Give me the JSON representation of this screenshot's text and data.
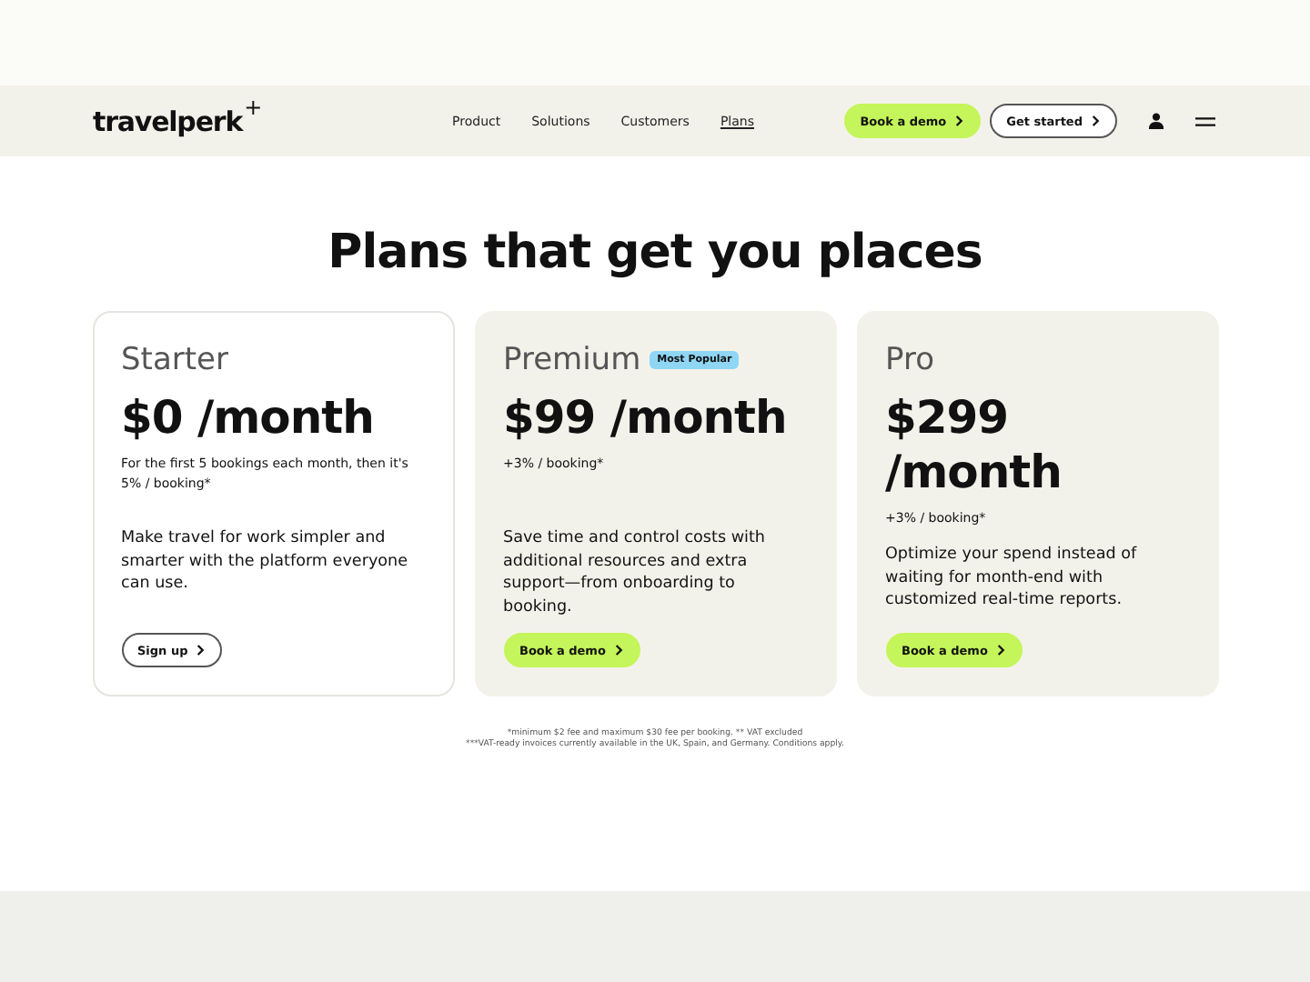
{
  "header": {
    "logo": "travelperk",
    "logo_mark": "+",
    "nav": [
      {
        "label": "Product",
        "selected": false
      },
      {
        "label": "Solutions",
        "selected": false
      },
      {
        "label": "Customers",
        "selected": false
      },
      {
        "label": "Plans",
        "selected": true
      }
    ],
    "buttons": [
      {
        "label": "Book a demo",
        "kind": "primary"
      },
      {
        "label": "Get started",
        "kind": "outline"
      }
    ]
  },
  "title": "Plans that get you places",
  "plans": [
    {
      "name": "Starter",
      "price": "$0 /month",
      "fee": "For the first 5 bookings each month, then it's 5% / booking*",
      "description": "Make travel for work simpler and smarter with the platform everyone can use.",
      "button": {
        "label": "Sign up",
        "kind": "outline"
      },
      "highlighted": false
    },
    {
      "name": "Premium",
      "badge": "Most Popular",
      "price": "$99 /month",
      "fee": "+3% / booking*",
      "description": "Save time and control costs with additional resources and extra support—from onboarding to booking.",
      "button": {
        "label": "Book a demo",
        "kind": "primary"
      },
      "highlighted": true
    },
    {
      "name": "Pro",
      "price": "$299 /month",
      "fee": "+3% / booking*",
      "description": "Optimize your spend instead of waiting for month-end with customized real-time reports.",
      "button": {
        "label": "Book a demo",
        "kind": "primary"
      },
      "highlighted": true
    }
  ],
  "footnotes": [
    "*minimum $2 fee and maximum $30 fee per booking. ** VAT excluded",
    "***VAT-ready invoices currently available in the UK, Spain, and Germany. Conditions apply."
  ]
}
